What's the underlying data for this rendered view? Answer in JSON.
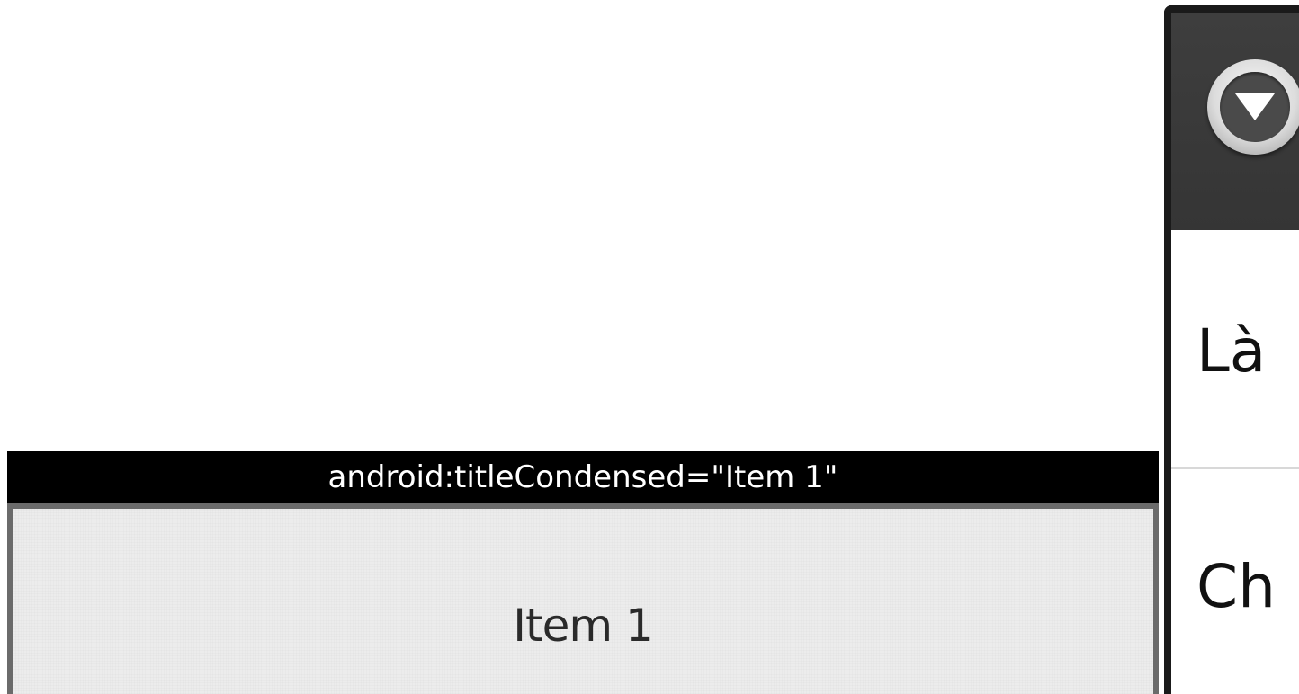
{
  "menu": {
    "caption": "android:titleCondensed=\"Item 1\"",
    "item_label": "Item 1"
  },
  "dialog": {
    "header_icon": "dropdown-icon",
    "rows": [
      {
        "label": "Là"
      },
      {
        "label": "Ch"
      }
    ]
  },
  "colors": {
    "caption_background": "#000000",
    "caption_text": "#ffffff",
    "menu_item_background": "#ececec",
    "menu_item_border": "#6b6b6b",
    "dialog_header_background": "#3a3a3a",
    "dialog_background": "#ffffff"
  }
}
